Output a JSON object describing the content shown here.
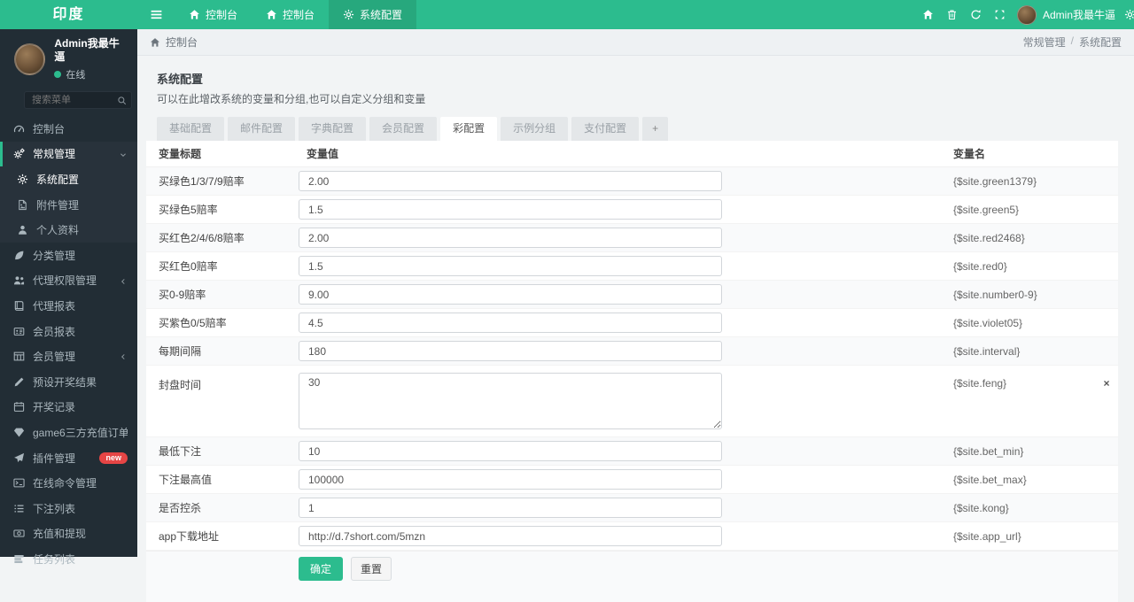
{
  "colors": {
    "accent_green": "#2cbc8e",
    "active_tab_green": "#27a87d",
    "sidebar_bg": "#222d35",
    "submenu_bg": "#28323b",
    "badge_red": "#e64545",
    "content_bg": "#f2f4f5"
  },
  "header": {
    "logo": "印度",
    "nav_tabs": [
      {
        "icon": "home",
        "label": "控制台",
        "active": false
      },
      {
        "icon": "home",
        "label": "控制台",
        "active": false
      },
      {
        "icon": "cog",
        "label": "系统配置",
        "active": true
      }
    ],
    "right_icons": [
      "home",
      "trash",
      "refresh",
      "expand"
    ],
    "user": {
      "name": "Admin我最牛逼"
    },
    "edge_icon": "cog"
  },
  "sidebar": {
    "user": {
      "name": "Admin我最牛逼",
      "status": "在线"
    },
    "search_placeholder": "搜索菜单",
    "menu": [
      {
        "icon": "gauge",
        "label": "控制台"
      },
      {
        "icon": "cogs",
        "label": "常规管理",
        "open": true,
        "children": [
          {
            "icon": "cog",
            "label": "系统配置",
            "active": true
          },
          {
            "icon": "file",
            "label": "附件管理"
          },
          {
            "icon": "user",
            "label": "个人资料"
          }
        ]
      },
      {
        "icon": "leaf",
        "label": "分类管理"
      },
      {
        "icon": "users",
        "label": "代理权限管理",
        "collapsed": true
      },
      {
        "icon": "book",
        "label": "代理报表"
      },
      {
        "icon": "idcard",
        "label": "会员报表"
      },
      {
        "icon": "table",
        "label": "会员管理",
        "collapsed": true
      },
      {
        "icon": "pencil",
        "label": "预设开奖结果"
      },
      {
        "icon": "calendar",
        "label": "开奖记录"
      },
      {
        "icon": "gem",
        "label": "game6三方充值订单"
      },
      {
        "icon": "rocket",
        "label": "插件管理",
        "badge": "new"
      },
      {
        "icon": "terminal",
        "label": "在线命令管理"
      },
      {
        "icon": "list",
        "label": "下注列表"
      },
      {
        "icon": "money",
        "label": "充值和提现"
      },
      {
        "icon": "tasks",
        "label": "任务列表"
      }
    ]
  },
  "breadcrumb": {
    "left": "控制台",
    "separator": "/",
    "right": [
      "常规管理",
      "系统配置"
    ]
  },
  "panel": {
    "title": "系统配置",
    "subtitle": "可以在此增改系统的变量和分组,也可以自定义分组和变量"
  },
  "tabs": {
    "items": [
      "基础配置",
      "邮件配置",
      "字典配置",
      "会员配置",
      "彩配置",
      "示例分组",
      "支付配置"
    ],
    "active": "彩配置",
    "add_label": "+"
  },
  "table": {
    "headers": [
      "变量标题",
      "变量值",
      "变量名"
    ],
    "remove_glyph": "×",
    "rows": [
      {
        "label": "买绿色1/3/7/9赔率",
        "value": "2.00",
        "var": "{$site.green1379}",
        "type": "input"
      },
      {
        "label": "买绿色5赔率",
        "value": "1.5",
        "var": "{$site.green5}",
        "type": "input"
      },
      {
        "label": "买红色2/4/6/8赔率",
        "value": "2.00",
        "var": "{$site.red2468}",
        "type": "input"
      },
      {
        "label": "买红色0赔率",
        "value": "1.5",
        "var": "{$site.red0}",
        "type": "input"
      },
      {
        "label": "买0-9赔率",
        "value": "9.00",
        "var": "{$site.number0-9}",
        "type": "input"
      },
      {
        "label": "买紫色0/5赔率",
        "value": "4.5",
        "var": "{$site.violet05}",
        "type": "input"
      },
      {
        "label": "每期间隔",
        "value": "180",
        "var": "{$site.interval}",
        "type": "input"
      },
      {
        "label": "封盘时间",
        "value": "30",
        "var": "{$site.feng}",
        "type": "textarea",
        "removable": true
      },
      {
        "label": "最低下注",
        "value": "10",
        "var": "{$site.bet_min}",
        "type": "input"
      },
      {
        "label": "下注最高值",
        "value": "100000",
        "var": "{$site.bet_max}",
        "type": "input"
      },
      {
        "label": "是否控杀",
        "value": "1",
        "var": "{$site.kong}",
        "type": "input"
      },
      {
        "label": "app下载地址",
        "value": "http://d.7short.com/5mzn",
        "var": "{$site.app_url}",
        "type": "input"
      }
    ],
    "buttons": {
      "submit": "确定",
      "reset": "重置"
    }
  }
}
